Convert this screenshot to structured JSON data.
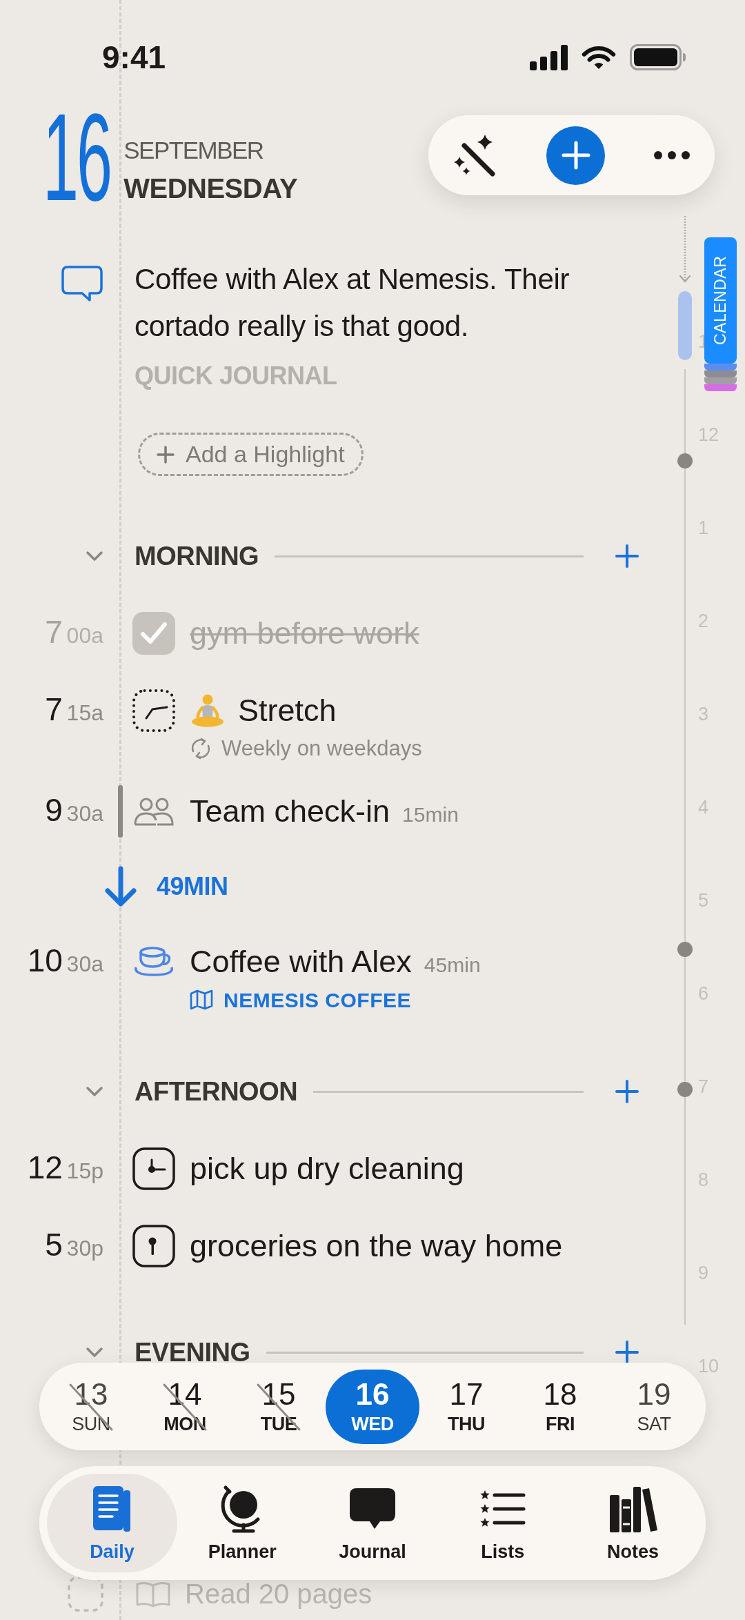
{
  "status_bar": {
    "time": "9:41"
  },
  "header": {
    "day": "16",
    "month": "SEPTEMBER",
    "weekday": "WEDNESDAY"
  },
  "journal": {
    "entry": "Coffee with Alex at Nemesis. Their cortado really is that good.",
    "label": "QUICK JOURNAL",
    "highlight_button": "Add a Highlight"
  },
  "sections": [
    {
      "title": "MORNING",
      "expanded": true,
      "items": [
        {
          "kind": "task",
          "hour": "7",
          "minutes": "00a",
          "title": "gym before work",
          "done": true
        },
        {
          "kind": "routine",
          "hour": "7",
          "minutes": "15a",
          "title": "Stretch",
          "repeat": "Weekly on weekdays",
          "done": false
        },
        {
          "kind": "meeting",
          "hour": "9",
          "minutes": "30a",
          "title": "Team check-in",
          "duration": "15min",
          "color": "#8e8984",
          "current": true
        },
        {
          "kind": "gap",
          "label": "49MIN"
        },
        {
          "kind": "cafe",
          "hour": "10",
          "minutes": "30a",
          "title": "Coffee with Alex",
          "duration": "45min",
          "location": "NEMESIS COFFEE",
          "color": "#4a86e8",
          "current": false
        }
      ]
    },
    {
      "title": "AFTERNOON",
      "expanded": true,
      "items": [
        {
          "kind": "timed",
          "hour": "12",
          "minutes": "15p",
          "title": "pick up dry cleaning",
          "done": false
        },
        {
          "kind": "located",
          "hour": "5",
          "minutes": "30p",
          "title": "groceries on the way home",
          "done": false
        }
      ]
    },
    {
      "title": "EVENING",
      "expanded": true
    }
  ],
  "tasks": [
    {
      "kind": "habit",
      "title": "Read 20 pages",
      "done": false
    }
  ],
  "timeline": {
    "hours": [
      "1",
      "12",
      "1",
      "2",
      "3",
      "4",
      "5",
      "6",
      "7",
      "8",
      "9",
      "10"
    ]
  },
  "calendar_tab": {
    "label": "CALENDAR",
    "layers": [
      {
        "color": "#5b8cf0"
      },
      {
        "color": "#8d8b93"
      },
      {
        "color": "#a29ea6"
      },
      {
        "color": "#d56ee3"
      }
    ]
  },
  "week": [
    {
      "date": "13",
      "day": "SUN",
      "past": true,
      "weekend": true,
      "selected": false
    },
    {
      "date": "14",
      "day": "MON",
      "past": true,
      "weekend": false,
      "selected": false
    },
    {
      "date": "15",
      "day": "TUE",
      "past": true,
      "weekend": false,
      "selected": false
    },
    {
      "date": "16",
      "day": "WED",
      "past": false,
      "weekend": false,
      "selected": true
    },
    {
      "date": "17",
      "day": "THU",
      "past": false,
      "weekend": false,
      "selected": false
    },
    {
      "date": "18",
      "day": "FRI",
      "past": false,
      "weekend": false,
      "selected": false
    },
    {
      "date": "19",
      "day": "SAT",
      "past": false,
      "weekend": true,
      "selected": false
    }
  ],
  "tabs": [
    {
      "label": "Daily",
      "selected": true
    },
    {
      "label": "Planner",
      "selected": false
    },
    {
      "label": "Journal",
      "selected": false
    },
    {
      "label": "Lists",
      "selected": false
    },
    {
      "label": "Notes",
      "selected": false
    }
  ]
}
